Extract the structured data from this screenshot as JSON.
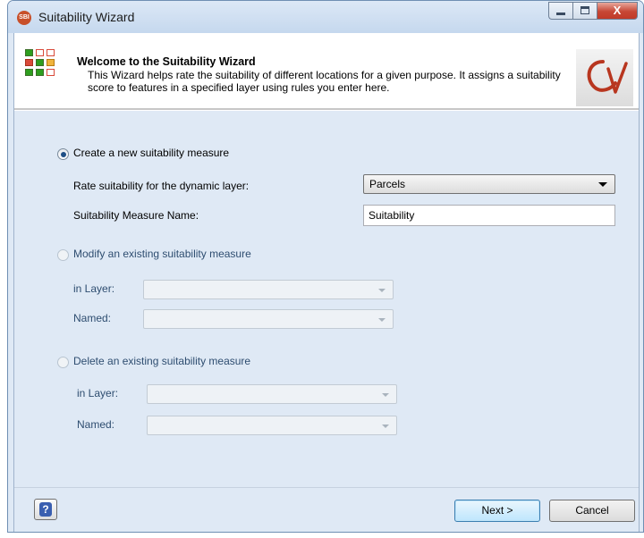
{
  "window": {
    "title": "Suitability Wizard",
    "app_icon_text": "SBI",
    "close_glyph": "X"
  },
  "header": {
    "title": "Welcome to the Suitability Wizard",
    "description": "This Wizard helps rate the suitability of different locations for a given purpose.  It assigns a suitability score to features in a specified layer using rules you enter here.",
    "logo_text": "CV",
    "grid_colors": [
      "#2e9e1f",
      "#d94a3a",
      "#f0b43c"
    ]
  },
  "options": {
    "create": {
      "label": "Create a new suitability measure",
      "selected": true,
      "layer_label": "Rate suitability for the dynamic layer:",
      "layer_value": "Parcels",
      "name_label": "Suitability Measure Name:",
      "name_value": "Suitability"
    },
    "modify": {
      "label": "Modify an existing suitability measure",
      "selected": false,
      "layer_label": "in Layer:",
      "named_label": "Named:",
      "layer_value": "",
      "named_value": ""
    },
    "delete": {
      "label": "Delete an existing suitability measure",
      "selected": false,
      "layer_label": "in Layer:",
      "named_label": "Named:",
      "layer_value": "",
      "named_value": ""
    }
  },
  "footer": {
    "help_glyph": "?",
    "next_label": "Next >",
    "cancel_label": "Cancel"
  }
}
